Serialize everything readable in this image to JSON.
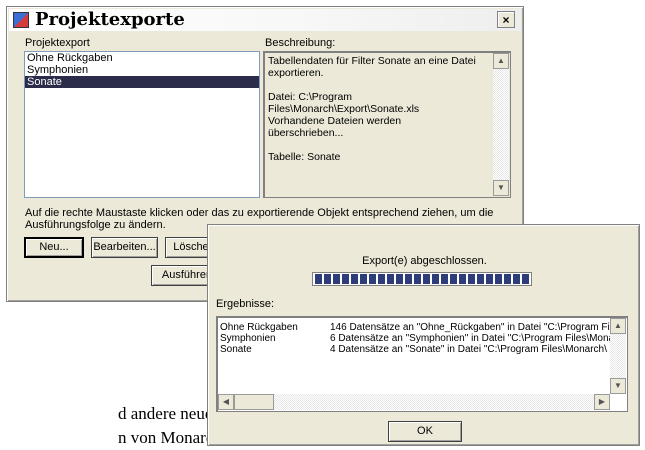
{
  "main": {
    "title": "Projektexporte",
    "close_label": "×",
    "list_label": "Projektexport",
    "items": [
      {
        "label": "Ohne Rückgaben"
      },
      {
        "label": "Symphonien"
      },
      {
        "label": "Sonate"
      }
    ],
    "selected_item": "Sonate",
    "desc_label": "Beschreibung:",
    "description_lines": [
      "Tabellendaten für Filter Sonate an eine Datei",
      "exportieren.",
      "",
      "Datei: C:\\Program",
      "Files\\Monarch\\Export\\Sonate.xls",
      "Vorhandene Dateien werden überschrieben...",
      "",
      "Tabelle: Sonate"
    ],
    "hint_line1": "Auf die rechte Maustaste klicken oder das zu exportierende Objekt entsprechend ziehen, um die",
    "hint_line2": "Ausführungsfolge zu ändern.",
    "buttons": {
      "new": "Neu...",
      "edit": "Bearbeiten...",
      "delete": "Löschen",
      "run": "Ausführen"
    }
  },
  "dialog": {
    "status": "Export(e) abgeschlossen.",
    "progress": 1.0,
    "results_label": "Ergebnisse:",
    "results": [
      {
        "name": "Ohne Rückgaben",
        "text": "146 Datensätze an \"Ohne_Rückgaben\" in Datei \"C:\\Program Fi"
      },
      {
        "name": "Symphonien",
        "text": "6 Datensätze an \"Symphonien\" in Datei \"C:\\Program Files\\Mona"
      },
      {
        "name": "Sonate",
        "text": "4 Datensätze an \"Sonate\" in Datei \"C:\\Program Files\\Monarch\\"
      }
    ],
    "ok_label": "OK"
  },
  "background_text": {
    "line1": "d andere neue",
    "line2": "n von Monarch"
  },
  "colors": {
    "window_bg": "#ece9d8",
    "selection": "#2b2b4a",
    "progress": "#2e3d7a"
  }
}
